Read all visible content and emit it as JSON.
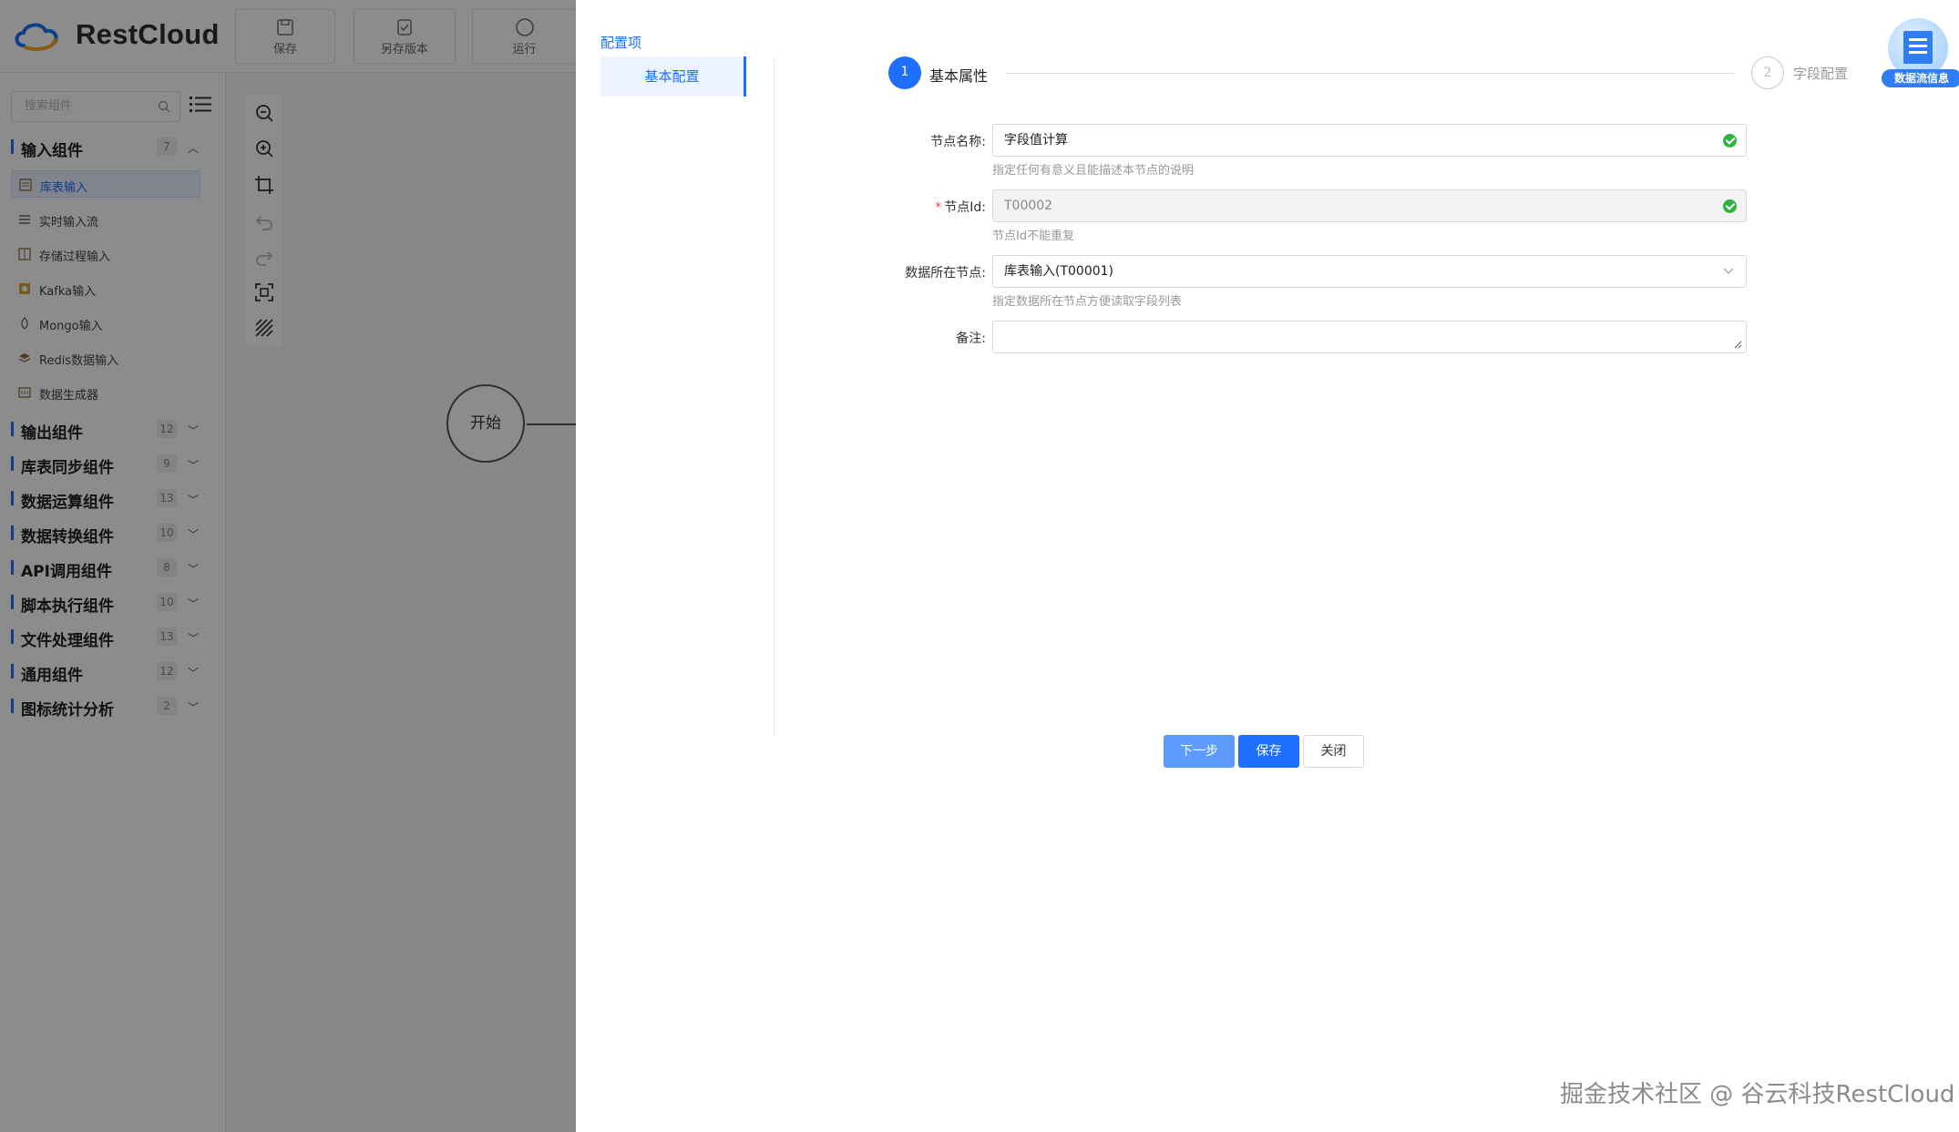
{
  "app": {
    "brand": "RestCloud",
    "toolbar": [
      {
        "label": "保存",
        "icon": "save-icon"
      },
      {
        "label": "另存版本",
        "icon": "save-version-icon"
      },
      {
        "label": "运行",
        "icon": "run-icon"
      }
    ],
    "search_placeholder": "搜索组件",
    "groups": [
      {
        "name": "输入组件",
        "count": "7",
        "expanded": true
      },
      {
        "name": "输出组件",
        "count": "12"
      },
      {
        "name": "库表同步组件",
        "count": "9"
      },
      {
        "name": "数据运算组件",
        "count": "13"
      },
      {
        "name": "数据转换组件",
        "count": "10"
      },
      {
        "name": "API调用组件",
        "count": "8"
      },
      {
        "name": "脚本执行组件",
        "count": "10"
      },
      {
        "name": "文件处理组件",
        "count": "13"
      },
      {
        "name": "通用组件",
        "count": "12"
      },
      {
        "name": "图标统计分析",
        "count": "2"
      }
    ],
    "input_items": [
      "库表输入",
      "实时输入流",
      "存储过程输入",
      "Kafka输入",
      "Mongo输入",
      "Redis数据输入",
      "数据生成器"
    ],
    "start_node": "开始"
  },
  "drawer": {
    "config_title": "配置项",
    "config_menu": "基本配置",
    "steps": [
      {
        "num": "1",
        "label": "基本属性",
        "active": true
      },
      {
        "num": "2",
        "label": "字段配置",
        "active": false
      }
    ],
    "form": {
      "node_name_label": "节点名称:",
      "node_name_value": "字段值计算",
      "node_name_hint": "指定任何有意义且能描述本节点的说明",
      "node_id_label": "节点Id:",
      "node_id_required": "*",
      "node_id_value": "T00002",
      "node_id_hint": "节点Id不能重复",
      "data_node_label": "数据所在节点:",
      "data_node_value": "库表输入(T00001)",
      "data_node_hint": "指定数据所在节点方便读取字段列表",
      "remark_label": "备注:",
      "remark_value": ""
    },
    "buttons": {
      "next": "下一步",
      "save": "保存",
      "close": "关闭"
    },
    "info_badge": "数据流信息"
  },
  "watermark": "掘金技术社区 @ 谷云科技RestCloud",
  "colors": {
    "accent": "#1e6fff",
    "success": "#2fb53c",
    "overlay": "rgba(0,0,0,0.45)"
  }
}
